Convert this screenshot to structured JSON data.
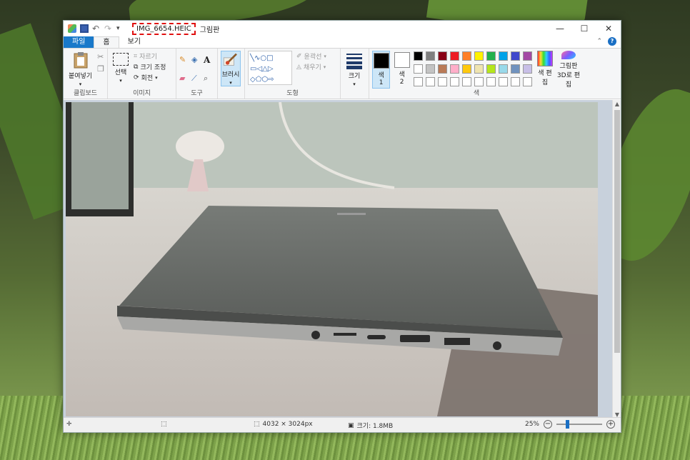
{
  "window": {
    "filename": "IMG_6654.HEIC",
    "app_name": "그림판",
    "minimize_glyph": "—",
    "maximize_glyph": "☐",
    "close_glyph": "✕"
  },
  "tabs": [
    {
      "label": "파일"
    },
    {
      "label": "홈"
    },
    {
      "label": "보기"
    }
  ],
  "ribbon": {
    "clipboard": {
      "paste": "붙여넣기",
      "group": "클립보드"
    },
    "image": {
      "select": "선택",
      "crop": "자르기",
      "resize": "크기 조정",
      "rotate": "회전",
      "group": "이미지"
    },
    "tools": {
      "group": "도구"
    },
    "brushes": {
      "label": "브러시"
    },
    "shapes": {
      "outline": "윤곽선",
      "fill": "채우기",
      "group": "도형"
    },
    "size": {
      "label": "크기"
    },
    "colors": {
      "color1": "색\n1",
      "color1_label": "색",
      "color1_num": "1",
      "color2_label": "색",
      "color2_num": "2",
      "edit": "색 편집",
      "paint3d": "그림판 3D로 편집",
      "group": "색",
      "palette": [
        "#000000",
        "#7f7f7f",
        "#880015",
        "#ed1c24",
        "#ff7f27",
        "#fff200",
        "#22b14c",
        "#00a2e8",
        "#3f48cc",
        "#a349a4",
        "#ffffff",
        "#c3c3c3",
        "#b97a57",
        "#ffaec9",
        "#ffc90e",
        "#efe4b0",
        "#b5e61d",
        "#99d9ea",
        "#7092be",
        "#c8bfe7",
        "#ffffff",
        "#ffffff",
        "#ffffff",
        "#ffffff",
        "#ffffff",
        "#ffffff",
        "#ffffff",
        "#ffffff",
        "#ffffff",
        "#ffffff"
      ]
    }
  },
  "statusbar": {
    "dimensions": "4032 × 3024px",
    "size": "크기: 1.8MB",
    "zoom": "25%",
    "zoom_fraction": 0.22
  },
  "colors": {
    "accent": "#1979ca",
    "highlight": "#e01010"
  }
}
